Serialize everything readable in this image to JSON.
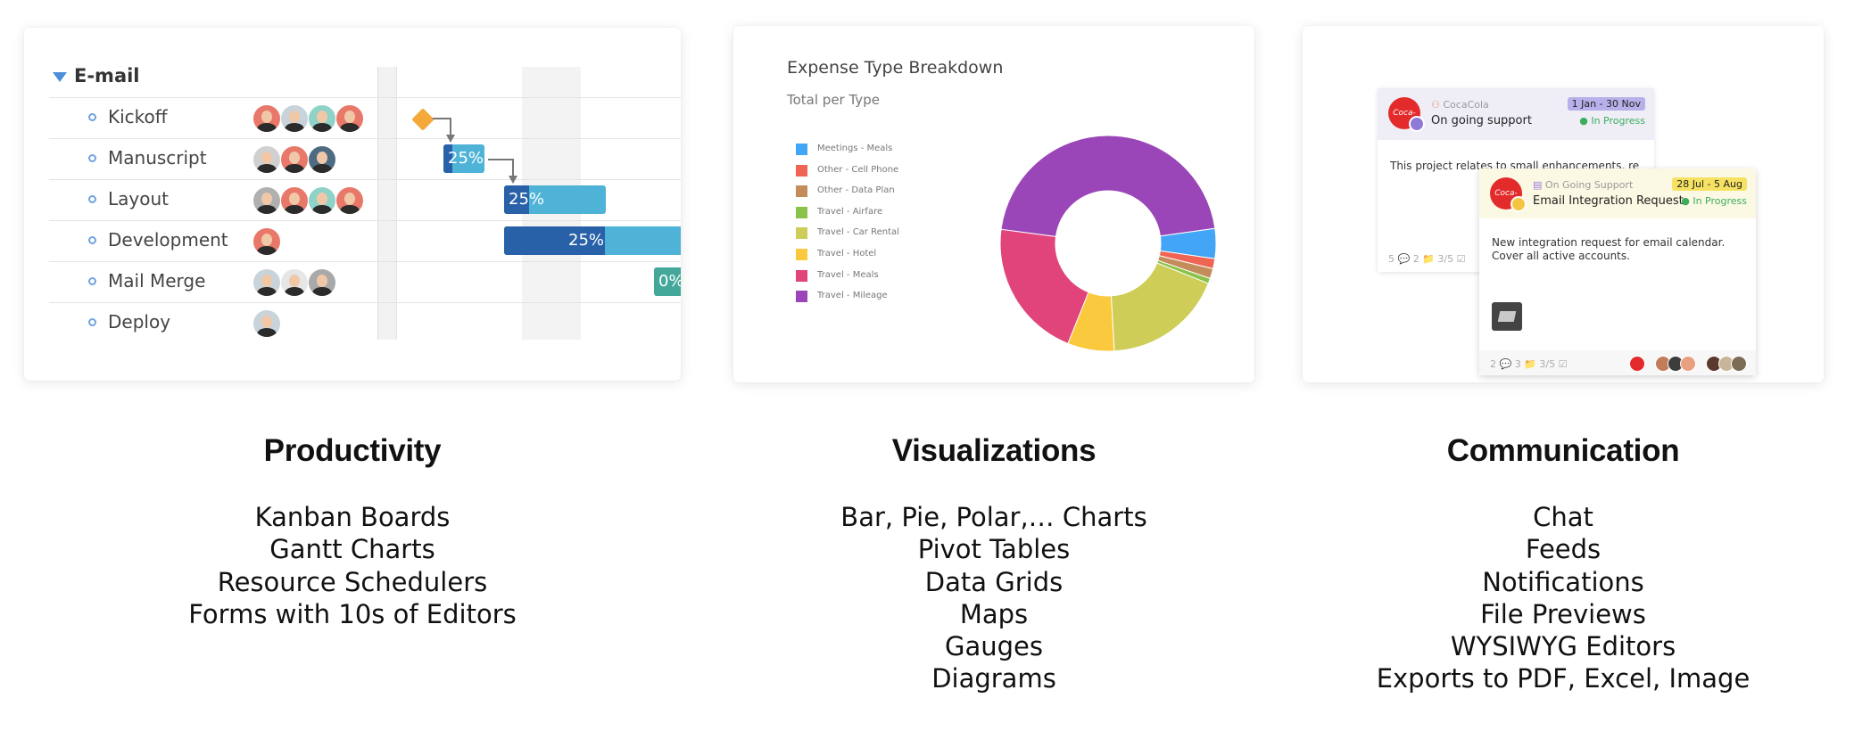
{
  "gantt": {
    "group": "E-mail",
    "tasks": [
      {
        "name": "Kickoff",
        "avatars": 4
      },
      {
        "name": "Manuscript",
        "avatars": 3
      },
      {
        "name": "Layout",
        "avatars": 4
      },
      {
        "name": "Development",
        "avatars": 1
      },
      {
        "name": "Mail Merge",
        "avatars": 3
      },
      {
        "name": "Deploy",
        "avatars": 1
      }
    ],
    "bar_labels": {
      "manuscript": "25%",
      "layout": "25%",
      "development": "25%",
      "mail_merge": "0%"
    },
    "colors": {
      "bar": "#4eb3d6",
      "done": "#2861a8",
      "teal": "#43a89a",
      "milestone": "#f4a93a"
    }
  },
  "chart_title": "Expense Type Breakdown",
  "chart_subtitle": "Total per Type",
  "chart_data": {
    "type": "pie",
    "variant": "donut",
    "categories": [
      "Meetings - Meals",
      "Other - Cell Phone",
      "Other - Data Plan",
      "Travel - Airfare",
      "Travel - Car Rental",
      "Travel - Hotel",
      "Travel - Meals",
      "Travel - Mileage"
    ],
    "values": [
      4.5,
      1.5,
      1.5,
      0.8,
      18,
      7,
      21,
      45.7
    ],
    "colors": [
      "#42a5f5",
      "#ef6453",
      "#c48c5a",
      "#8bc34a",
      "#cdcd57",
      "#fbc93d",
      "#e0447a",
      "#9a45b8"
    ],
    "legend_position": "left"
  },
  "messages": [
    {
      "tag": "CocaCola",
      "title": "On going support",
      "date": "1 Jan - 30 Nov",
      "status": "In Progress",
      "body": "This project relates to small enhancements, re",
      "footer": "5 💬   2 📁   3/5 ☑",
      "logo": "Coca-Cola"
    },
    {
      "tag": "On Going Support",
      "title": "Email Integration Request",
      "date": "28 Jul - 5 Aug",
      "status": "In Progress",
      "body1": "New integration request for email calendar.",
      "body2": "Cover all active accounts.",
      "footer": "2 💬   3 📁   3/5 ☑",
      "logo": "Coca-Cola"
    }
  ],
  "columns": [
    {
      "title": "Productivity",
      "items": [
        "Kanban Boards",
        "Gantt Charts",
        "Resource Schedulers",
        "Forms with 10s of Editors"
      ]
    },
    {
      "title": "Visualizations",
      "items": [
        "Bar, Pie, Polar,… Charts",
        "Pivot Tables",
        "Data Grids",
        "Maps",
        "Gauges",
        "Diagrams"
      ]
    },
    {
      "title": "Communication",
      "items": [
        "Chat",
        "Feeds",
        "Notifications",
        "File Previews",
        "WYSIWYG Editors",
        "Exports to PDF, Excel, Image"
      ]
    }
  ]
}
